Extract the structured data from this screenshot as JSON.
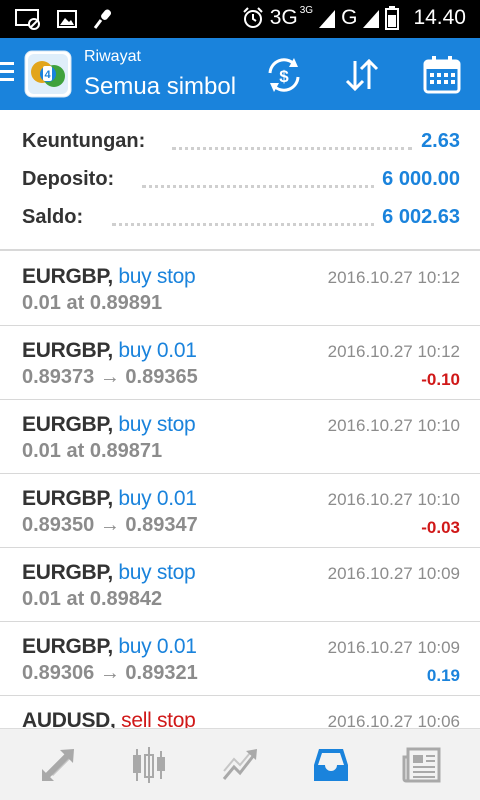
{
  "status_bar": {
    "network_3g": "3G",
    "network_3g_small": "3G",
    "network_g": "G",
    "time": "14.40"
  },
  "appbar": {
    "subtitle": "Riwayat",
    "title": "Semua simbol"
  },
  "summary": {
    "rows": [
      {
        "label": "Keuntungan:",
        "value": "2.63"
      },
      {
        "label": "Deposito:",
        "value": "6 000.00"
      },
      {
        "label": "Saldo:",
        "value": "6 002.63"
      }
    ]
  },
  "orders": [
    {
      "symbol": "EURGBP,",
      "type": "buy stop",
      "detail": "0.01 at 0.89891",
      "time": "2016.10.27 10:12",
      "profit": ""
    },
    {
      "symbol": "EURGBP,",
      "type": "buy 0.01",
      "detail": "0.89373 → 0.89365",
      "time": "2016.10.27 10:12",
      "profit": "-0.10"
    },
    {
      "symbol": "EURGBP,",
      "type": "buy stop",
      "detail": "0.01 at 0.89871",
      "time": "2016.10.27 10:10",
      "profit": ""
    },
    {
      "symbol": "EURGBP,",
      "type": "buy 0.01",
      "detail": "0.89350 → 0.89347",
      "time": "2016.10.27 10:10",
      "profit": "-0.03"
    },
    {
      "symbol": "EURGBP,",
      "type": "buy stop",
      "detail": "0.01 at 0.89842",
      "time": "2016.10.27 10:09",
      "profit": ""
    },
    {
      "symbol": "EURGBP,",
      "type": "buy 0.01",
      "detail": "0.89306 → 0.89321",
      "time": "2016.10.27 10:09",
      "profit": "0.19"
    },
    {
      "symbol": "AUDUSD,",
      "type": "sell stop",
      "detail": "",
      "time": "2016.10.27 10:06",
      "profit": ""
    }
  ],
  "icons": {
    "appbar": [
      "currency-exchange-icon",
      "sort-icon",
      "calendar-icon"
    ],
    "bottom_nav": [
      "quotes-icon",
      "chart-icon",
      "trade-icon",
      "history-icon",
      "news-icon"
    ]
  },
  "colors": {
    "accent": "#1a83dc",
    "negative": "#d01818",
    "muted": "#8c8c8c"
  }
}
